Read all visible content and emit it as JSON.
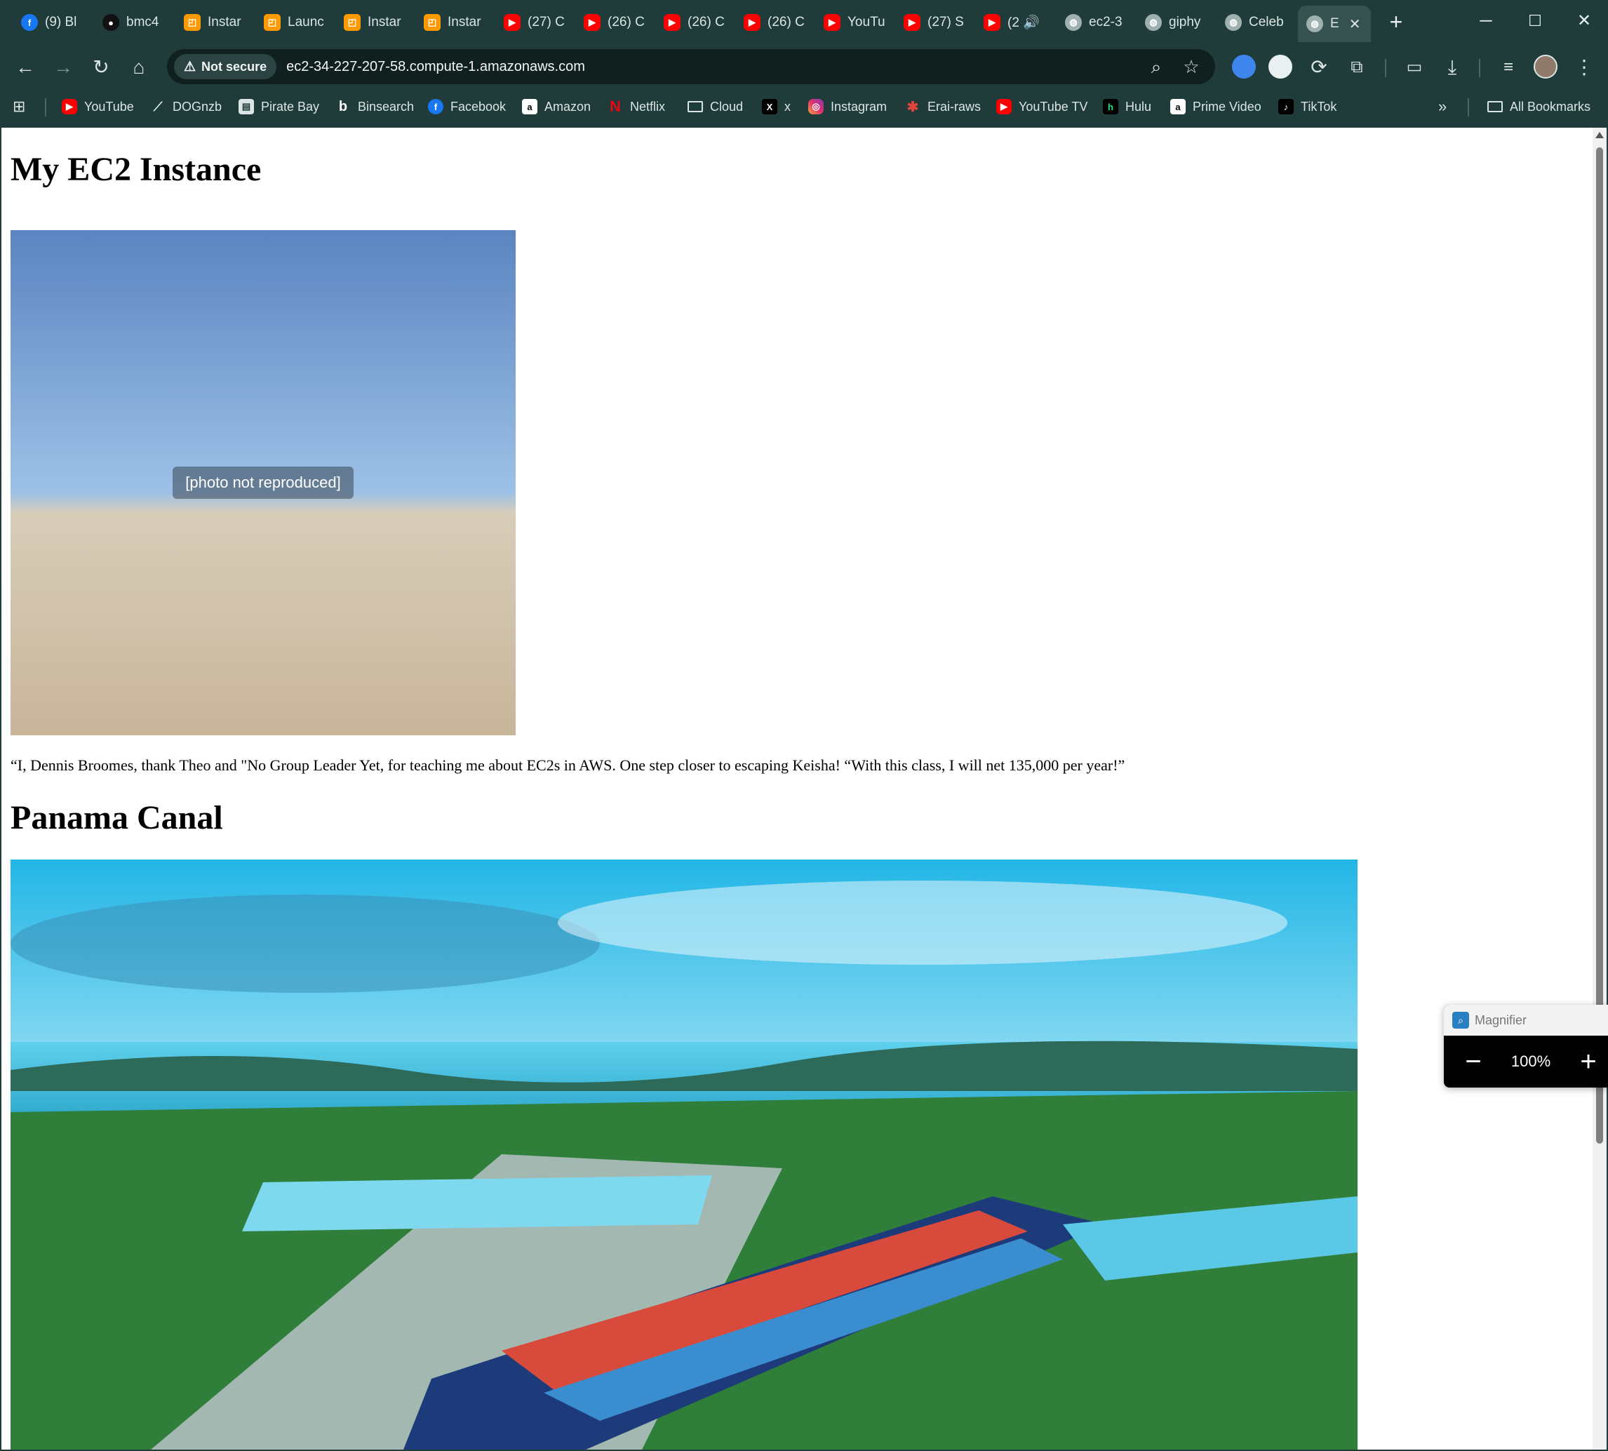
{
  "tabs": [
    {
      "label": "(9) Bl",
      "icon": "facebook-icon"
    },
    {
      "label": "bmc4",
      "icon": "github-icon"
    },
    {
      "label": "Instar",
      "icon": "aws-icon"
    },
    {
      "label": "Launc",
      "icon": "aws-icon"
    },
    {
      "label": "Instar",
      "icon": "aws-icon"
    },
    {
      "label": "Instar",
      "icon": "aws-icon"
    },
    {
      "label": "(27) C",
      "icon": "youtube-icon"
    },
    {
      "label": "(26) C",
      "icon": "youtube-icon"
    },
    {
      "label": "(26) C",
      "icon": "youtube-icon"
    },
    {
      "label": "(26) C",
      "icon": "youtube-icon"
    },
    {
      "label": "YouTu",
      "icon": "youtube-icon"
    },
    {
      "label": "(27) S",
      "icon": "youtube-icon"
    },
    {
      "label": "(2 🔊",
      "icon": "youtube-icon"
    },
    {
      "label": "ec2-3",
      "icon": "globe-icon"
    },
    {
      "label": "giphy",
      "icon": "globe-icon"
    },
    {
      "label": "Celeb",
      "icon": "globe-icon"
    },
    {
      "label": "E",
      "icon": "globe-icon",
      "active": true
    }
  ],
  "address_bar": {
    "security_label": "Not secure",
    "url": "ec2-34-227-207-58.compute-1.amazonaws.com"
  },
  "bookmarks": [
    {
      "label": "YouTube",
      "icon": "youtube-icon",
      "glyph": "▶"
    },
    {
      "label": "DOGnzb",
      "icon": "dognzb-icon",
      "glyph": "⟋"
    },
    {
      "label": "Pirate Bay",
      "icon": "piratebay-icon",
      "glyph": "▤"
    },
    {
      "label": "Binsearch",
      "icon": "binsearch-icon",
      "glyph": "b"
    },
    {
      "label": "Facebook",
      "icon": "facebook-icon",
      "glyph": "f"
    },
    {
      "label": "Amazon",
      "icon": "amazon-icon",
      "glyph": "a"
    },
    {
      "label": "Netflix",
      "icon": "netflix-icon",
      "glyph": "N"
    },
    {
      "label": "Cloud",
      "icon": "folder-icon",
      "glyph": ""
    },
    {
      "label": "x",
      "icon": "x-icon",
      "glyph": "X"
    },
    {
      "label": "Instagram",
      "icon": "instagram-icon",
      "glyph": "◎"
    },
    {
      "label": "Erai-raws",
      "icon": "erai-icon",
      "glyph": "✱"
    },
    {
      "label": "YouTube TV",
      "icon": "youtube-icon",
      "glyph": "▶"
    },
    {
      "label": "Hulu",
      "icon": "hulu-icon",
      "glyph": "h"
    },
    {
      "label": "Prime Video",
      "icon": "amazon-icon",
      "glyph": "a"
    },
    {
      "label": "TikTok",
      "icon": "tiktok-icon",
      "glyph": "♪"
    }
  ],
  "all_bookmarks_label": "All Bookmarks",
  "page": {
    "title": "My EC2 Instance",
    "quote": "“I, Dennis Broomes, thank Theo and \"No Group Leader Yet, for teaching me about EC2s in AWS. One step closer to escaping Keisha! “With this class, I will net 135,000 per year!”",
    "section_title": "Panama Canal"
  },
  "magnifier": {
    "title": "Magnifier",
    "zoom": "100%"
  },
  "colors": {
    "chrome_bg": "#1f3b3a",
    "omnibox_bg": "#10201f"
  }
}
